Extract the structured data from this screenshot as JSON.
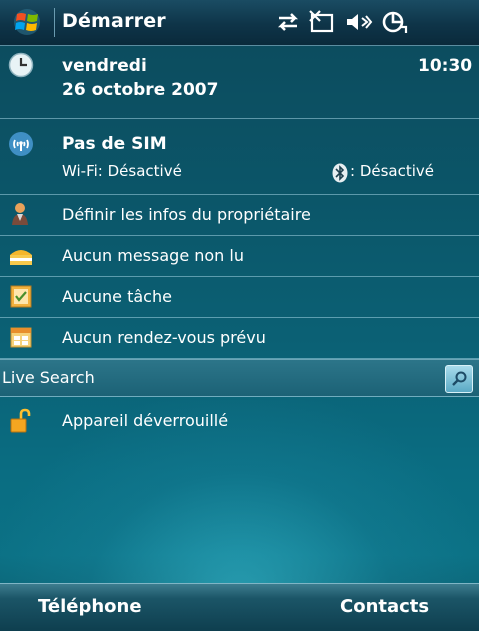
{
  "top_bar": {
    "start_label": "Démarrer",
    "status_icons": [
      "connectivity-icon",
      "no-signal-icon",
      "speaker-muted-icon",
      "sync-icon"
    ]
  },
  "today": {
    "day_name": "vendredi",
    "date": "26 octobre 2007",
    "time": "10:30",
    "sim_title": "Pas de SIM",
    "wifi_status": "Wi-Fi: Désactivé",
    "bluetooth_status": ": Désactivé",
    "owner_info": "Définir les infos du propriétaire",
    "messages": "Aucun message non lu",
    "tasks": "Aucune tâche",
    "appointments": "Aucun rendez-vous prévu",
    "search_label": "Live Search",
    "device_lock": "Appareil déverrouillé"
  },
  "softkeys": {
    "left": "Téléphone",
    "right": "Contacts"
  },
  "colors": {
    "background_top": "#0d4a5c",
    "background_bottom": "#0a6d82",
    "text": "#ffffff"
  }
}
